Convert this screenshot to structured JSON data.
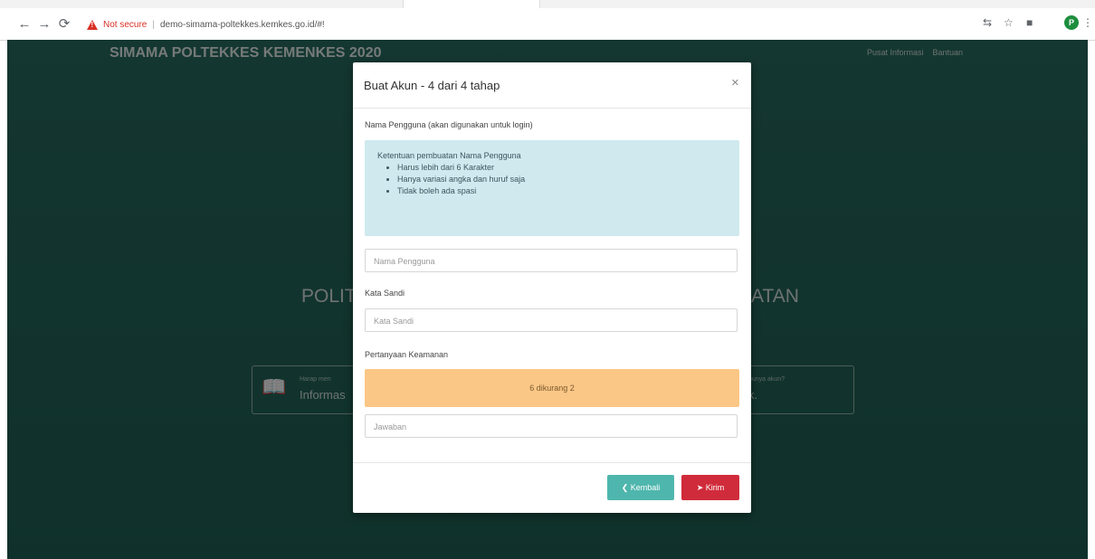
{
  "browser": {
    "not_secure": "Not secure",
    "url": "demo-simama-poltekkes.kemkes.go.id/#!",
    "profile_initial": "P"
  },
  "site": {
    "brand": "SIMAMA POLTEKKES KEMENKES 2020",
    "nav": [
      "Pusat Informasi",
      "Bantuan"
    ],
    "hero_left": "POLIT",
    "hero_right": "ATAN",
    "info_small": "Harap men",
    "info_big": "Informas",
    "account_small": "punya akun?",
    "account_big": "k."
  },
  "modal": {
    "title": "Buat Akun - 4 dari 4 tahap",
    "close": "×",
    "username_label": "Nama Pengguna (akan digunakan untuk login)",
    "rules_title": "Ketentuan pembuatan Nama Pengguna",
    "rules": [
      "Harus lebih dari 6 Karakter",
      "Hanya variasi angka dan huruf saja",
      "Tidak boleh ada spasi"
    ],
    "username_placeholder": "Nama Pengguna",
    "password_label": "Kata Sandi",
    "password_placeholder": "Kata Sandi",
    "security_label": "Pertanyaan Keamanan",
    "security_question": "6 dikurang 2",
    "answer_placeholder": "Jawaban",
    "back_button": "❮ Kembali",
    "send_button": "➤ Kirim"
  },
  "colors": {
    "page_bg": "#266459",
    "alert_bg": "#cfe9ee",
    "question_bg": "#fbc786",
    "back_button": "#4fb6ad",
    "send_button": "#d02b3a"
  }
}
